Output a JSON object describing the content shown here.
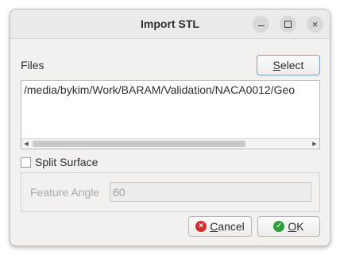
{
  "window": {
    "title": "Import STL"
  },
  "titlebar_buttons": {
    "minimize_icon": "minimize-icon",
    "maximize_icon": "maximize-icon",
    "close_icon": "close-icon",
    "close_glyph": "×"
  },
  "files": {
    "label": "Files",
    "select_button": {
      "accel": "S",
      "rest": "elect"
    },
    "path": "/media/bykim/Work/BARAM/Validation/NACA0012/Geo"
  },
  "scrollbar": {
    "left_arrow": "◀",
    "right_arrow": "▶"
  },
  "split_surface": {
    "label": "Split Surface",
    "checked": false
  },
  "feature_angle": {
    "label": "Feature Angle",
    "value": "60",
    "enabled": false
  },
  "buttons": {
    "cancel": {
      "icon": "cancel-icon",
      "icon_glyph": "×",
      "accel": "C",
      "rest": "ancel"
    },
    "ok": {
      "icon": "ok-icon",
      "icon_glyph": "✓",
      "accel": "O",
      "rest": "K"
    }
  }
}
